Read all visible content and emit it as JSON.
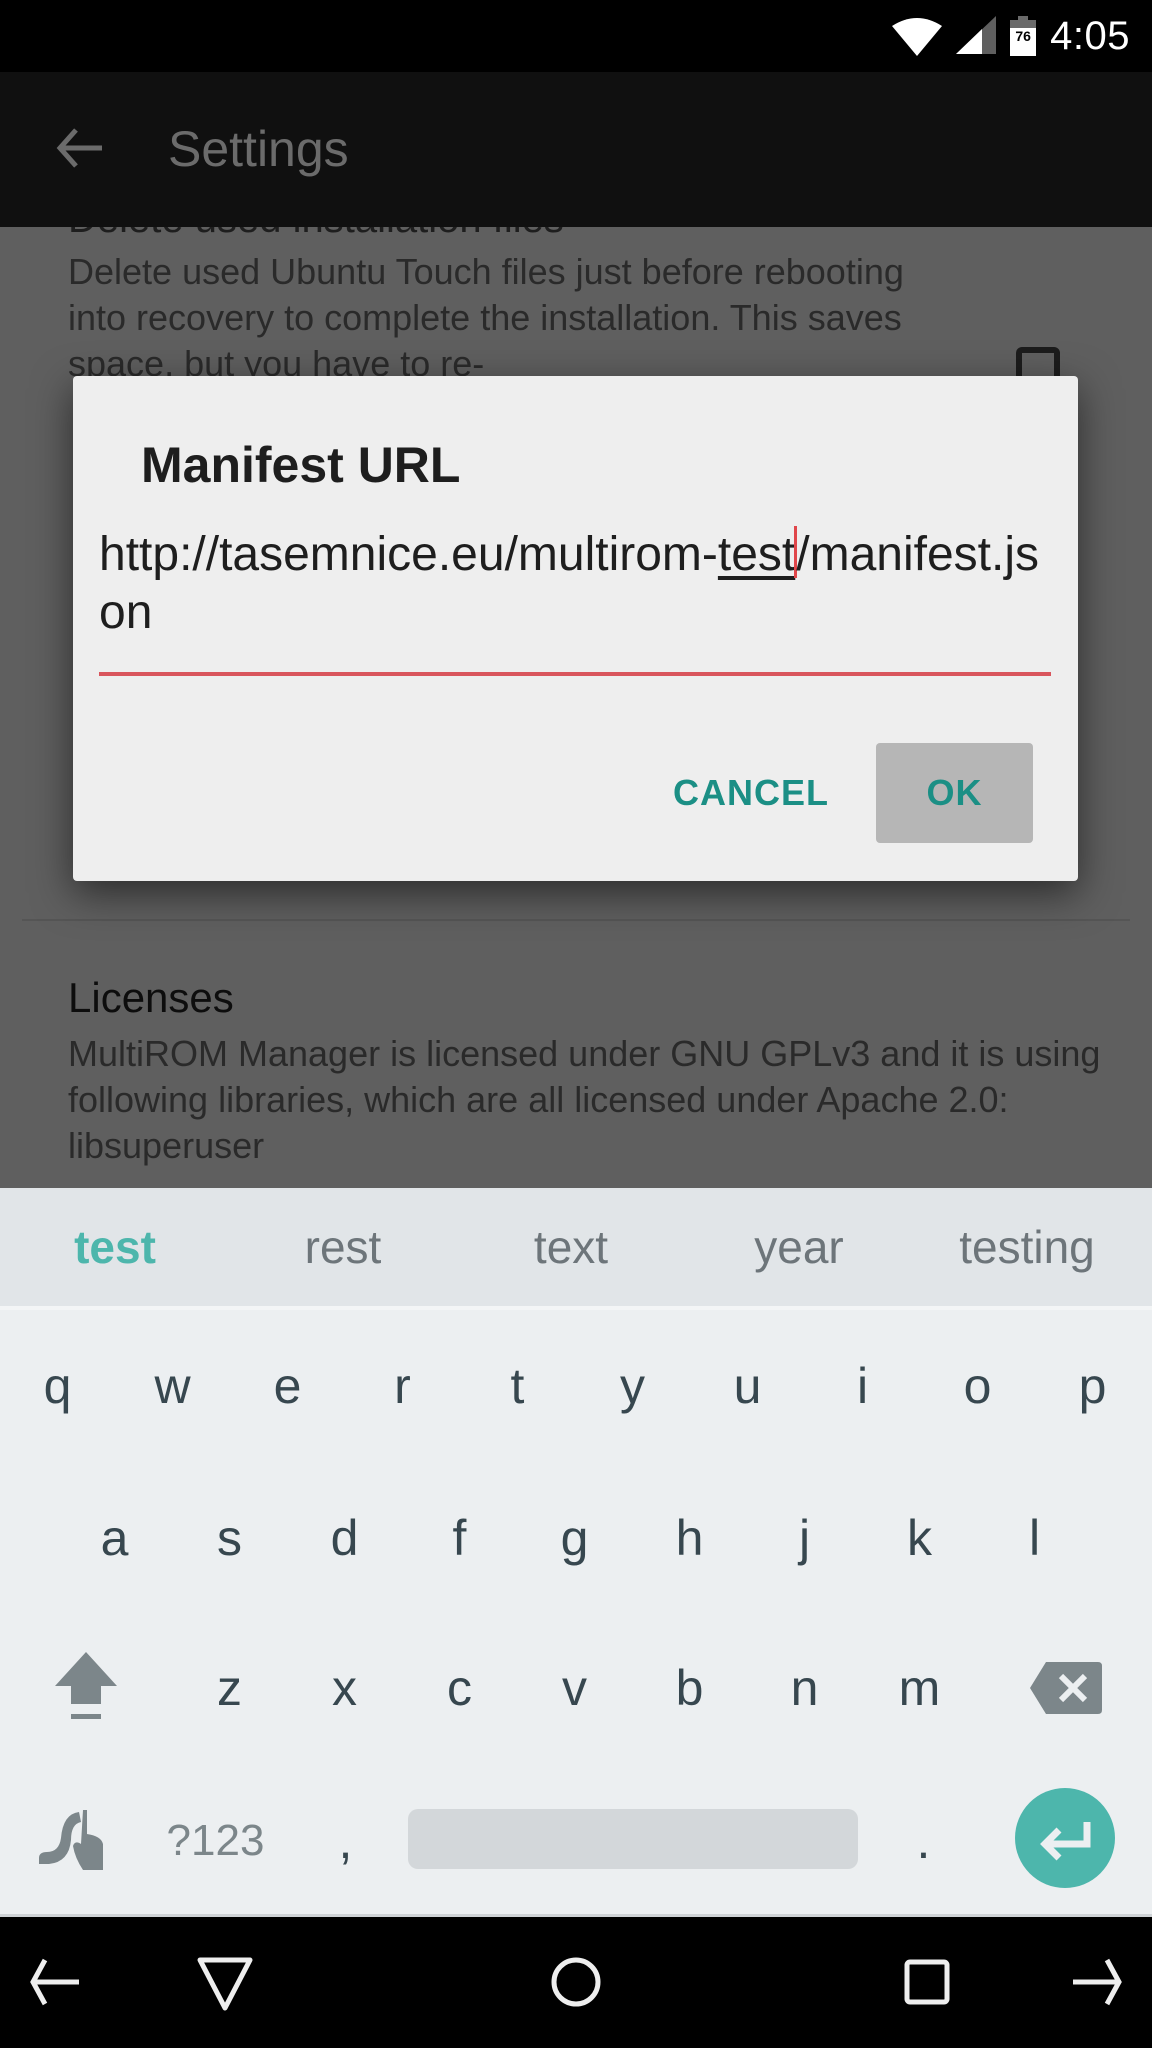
{
  "status_bar": {
    "time": "4:05",
    "battery_level": "76",
    "icons": [
      "wifi-icon",
      "cell-signal-icon",
      "battery-icon"
    ]
  },
  "app_bar": {
    "title": "Settings",
    "back_icon": "arrow-back-icon"
  },
  "settings": {
    "partial_title": "Delete used installation files",
    "delete_files_summary": "Delete used Ubuntu Touch files just before rebooting into recovery to complete the installation. This saves space, but you have to re-",
    "delete_files_checked": false,
    "licenses_title": "Licenses",
    "licenses_summary": "MultiROM Manager is licensed under GNU GPLv3 and it is using following libraries, which are all licensed under Apache 2.0:",
    "licenses_partial_next_line": "libsuperuser"
  },
  "dialog": {
    "title": "Manifest URL",
    "input_before_suggestion": "http://tasemnice.eu/multirom-",
    "input_suggestion_word": "test",
    "input_after_caret": "/manifest.json",
    "input_value": "http://tasemnice.eu/multirom-test/manifest.json",
    "cancel_label": "CANCEL",
    "ok_label": "OK",
    "accent_color": "#1b8f85",
    "error_underline_color": "#d9555c"
  },
  "keyboard": {
    "suggestions": [
      "test",
      "rest",
      "text",
      "year",
      "testing"
    ],
    "row1": [
      "q",
      "w",
      "e",
      "r",
      "t",
      "y",
      "u",
      "i",
      "o",
      "p"
    ],
    "row2": [
      "a",
      "s",
      "d",
      "f",
      "g",
      "h",
      "j",
      "k",
      "l"
    ],
    "row3": [
      "z",
      "x",
      "c",
      "v",
      "b",
      "n",
      "m"
    ],
    "symbols_label": "?123",
    "comma": ",",
    "period": ".",
    "accent_color": "#4db6ac"
  },
  "nav_bar": {
    "buttons": [
      "nav-left-arrow-icon",
      "hide-keyboard-icon",
      "home-icon",
      "recents-icon",
      "nav-right-arrow-icon"
    ]
  }
}
